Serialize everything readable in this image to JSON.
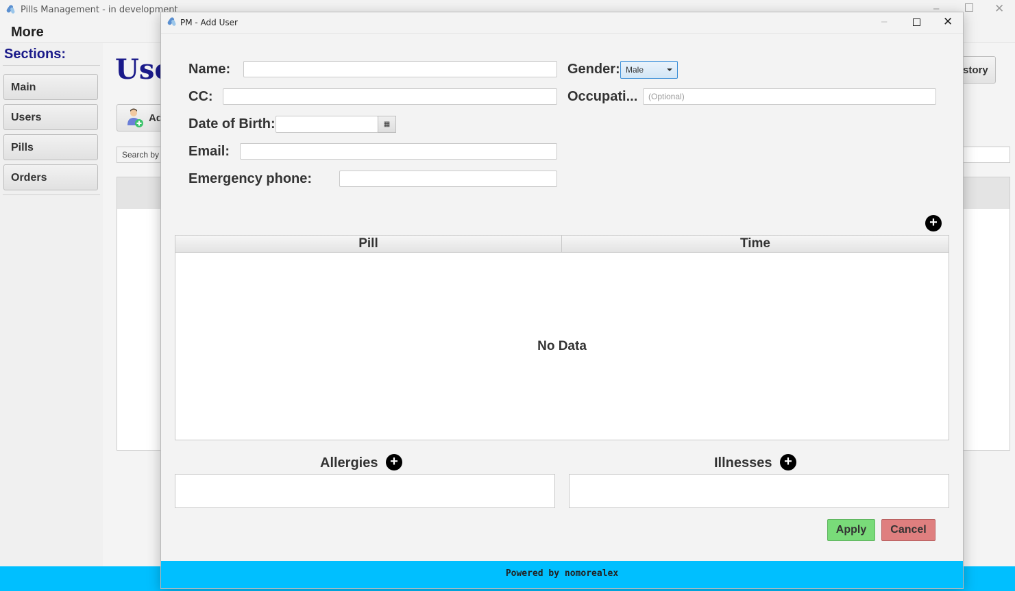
{
  "main_window": {
    "title": "Pills Management - in development",
    "menu": [
      "More"
    ],
    "sidebar": {
      "title": "Sections:",
      "items": [
        "Main",
        "Users",
        "Pills",
        "Orders"
      ]
    },
    "content": {
      "heading_visible": "Use",
      "add_button_visible": "Ad",
      "search_placeholder_visible": "Search by",
      "history_button_visible": "story"
    },
    "footer_color": "#00bfff"
  },
  "dialog": {
    "title": "PM - Add User",
    "labels": {
      "name": "Name:",
      "gender": "Gender:",
      "cc": "CC:",
      "occupation": "Occupati...",
      "dob": "Date of Birth:",
      "email": "Email:",
      "emergency": "Emergency phone:"
    },
    "fields": {
      "name": "",
      "cc": "",
      "dob": "",
      "email": "",
      "emergency": "",
      "occupation_placeholder": "(Optional)",
      "gender_selected": "Male"
    },
    "pill_table": {
      "columns": [
        "Pill",
        "Time"
      ],
      "empty_text": "No Data"
    },
    "allergies_label": "Allergies",
    "illnesses_label": "Illnesses",
    "apply_label": "Apply",
    "cancel_label": "Cancel",
    "footer_text": "Powered by nomorealex",
    "colors": {
      "apply": "#79db79",
      "cancel": "#df7f7f",
      "footer": "#00bfff",
      "heading": "#1a1a8a"
    }
  }
}
